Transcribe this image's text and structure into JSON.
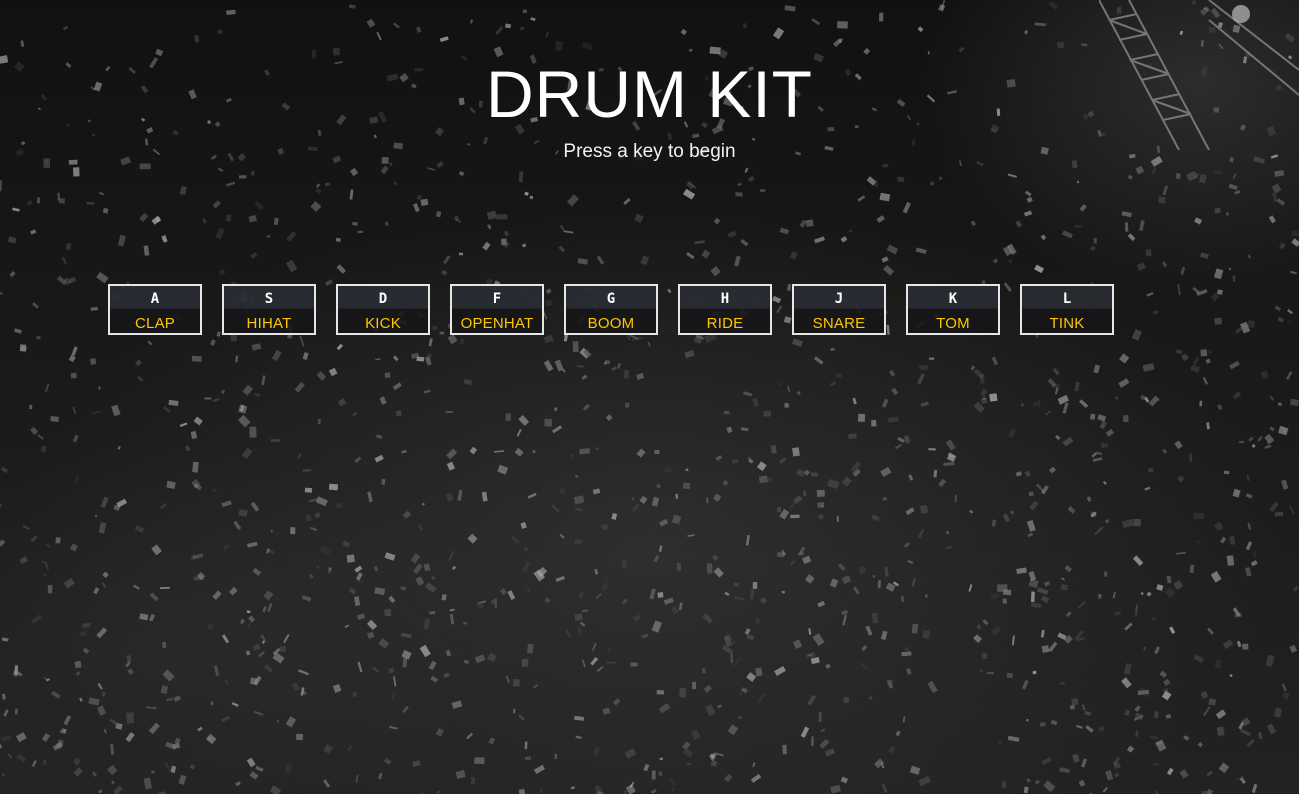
{
  "header": {
    "title": "DRUM KIT",
    "subtitle": "Press a key to begin"
  },
  "colors": {
    "accent": "#ffc600",
    "text": "#ffffff",
    "key_border": "#e6e6e6",
    "background": "#111111"
  },
  "keys": [
    {
      "key": "A",
      "sound": "CLAP"
    },
    {
      "key": "S",
      "sound": "HIHAT"
    },
    {
      "key": "D",
      "sound": "KICK"
    },
    {
      "key": "F",
      "sound": "OPENHAT"
    },
    {
      "key": "G",
      "sound": "BOOM"
    },
    {
      "key": "H",
      "sound": "RIDE"
    },
    {
      "key": "J",
      "sound": "SNARE"
    },
    {
      "key": "K",
      "sound": "TOM"
    },
    {
      "key": "L",
      "sound": "TINK"
    }
  ]
}
